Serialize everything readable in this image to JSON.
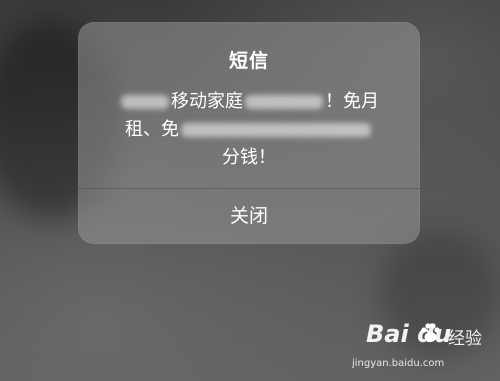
{
  "dialog": {
    "title": "短信",
    "message": {
      "line1_a": "",
      "line1_b": "移动家庭",
      "line1_c": "！免月",
      "line2_a": "租、免",
      "line3": "分钱！"
    },
    "close_label": "关闭"
  },
  "watermark": {
    "logo_text": "Bai du",
    "brand_suffix": "经验",
    "url": "jingyan.baidu.com"
  },
  "colors": {
    "dialog_bg": "#9a9a9a",
    "text": "#ffffff",
    "background": "#444444"
  }
}
